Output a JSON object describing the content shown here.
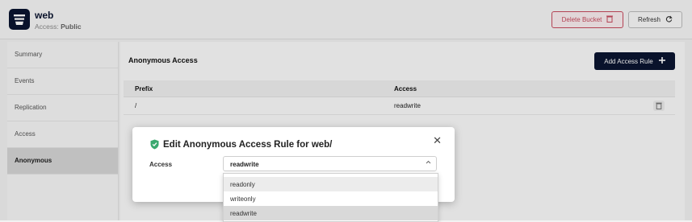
{
  "header": {
    "bucket_name": "web",
    "access_label": "Access:",
    "access_value": "Public",
    "delete_label": "Delete Bucket",
    "refresh_label": "Refresh"
  },
  "sidebar": {
    "items": [
      {
        "label": "Summary"
      },
      {
        "label": "Events"
      },
      {
        "label": "Replication"
      },
      {
        "label": "Access"
      },
      {
        "label": "Anonymous",
        "active": true
      }
    ]
  },
  "main": {
    "title": "Anonymous Access",
    "add_rule_label": "Add Access Rule",
    "table": {
      "columns": [
        "Prefix",
        "Access"
      ],
      "rows": [
        {
          "prefix": "/",
          "access": "readwrite"
        }
      ]
    }
  },
  "modal": {
    "title": "Edit Anonymous Access Rule for web/",
    "close_symbol": "✕",
    "field_label": "Access",
    "selected_value": "readwrite",
    "options": [
      "readonly",
      "writeonly",
      "readwrite"
    ]
  },
  "colors": {
    "primary": "#0b1530",
    "danger": "#c84b5e",
    "shield_green": "#3aa86f"
  }
}
